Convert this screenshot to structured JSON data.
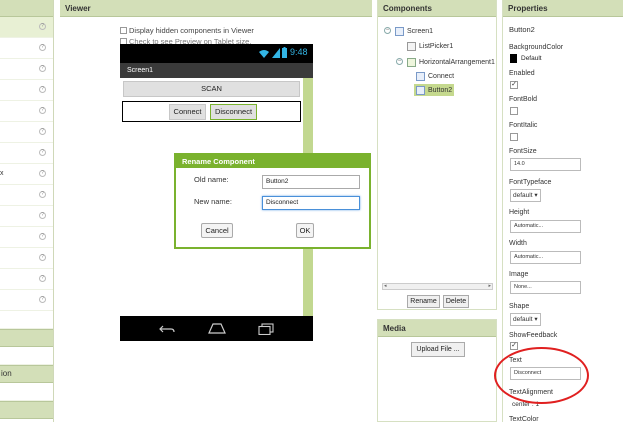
{
  "viewer": {
    "header": "Viewer",
    "display_hidden": "Display hidden components in Viewer",
    "preview_tablet": "Check to see Preview on Tablet size."
  },
  "phone": {
    "time": "9:48",
    "screen_title": "Screen1",
    "scan_label": "SCAN",
    "connect_label": "Connect",
    "disconnect_label": "Disconnect"
  },
  "rename_dialog": {
    "title": "Rename Component",
    "old_name_label": "Old name:",
    "old_name_value": "Button2",
    "new_name_label": "New name:",
    "new_name_value": "Disconnect",
    "cancel_label": "Cancel",
    "ok_label": "OK"
  },
  "palette": {
    "partial_x": "x",
    "partial_group": "ion"
  },
  "components": {
    "header": "Components",
    "tree": {
      "screen1": "Screen1",
      "listpicker1": "ListPicker1",
      "harr1": "HorizontalArrangement1",
      "connect": "Connect",
      "button2": "Button2"
    },
    "rename_label": "Rename",
    "delete_label": "Delete"
  },
  "media": {
    "header": "Media",
    "upload_label": "Upload File ..."
  },
  "properties": {
    "header": "Properties",
    "component_name": "Button2",
    "background_color_label": "BackgroundColor",
    "background_color_value": "Default",
    "enabled_label": "Enabled",
    "fontbold_label": "FontBold",
    "fontitalic_label": "FontItalic",
    "fontsize_label": "FontSize",
    "fontsize_value": "14.0",
    "fonttypeface_label": "FontTypeface",
    "fonttypeface_value": "default",
    "height_label": "Height",
    "height_value": "Automatic...",
    "width_label": "Width",
    "width_value": "Automatic...",
    "image_label": "Image",
    "image_value": "None...",
    "shape_label": "Shape",
    "shape_value": "default",
    "showfeedback_label": "ShowFeedback",
    "text_label": "Text",
    "text_value": "Disconnect",
    "textalignment_label": "TextAlignment",
    "textalignment_value": "center : 1",
    "textcolor_label": "TextColor"
  },
  "colors": {
    "accent": "#7ab22e",
    "header_bg": "#d3dfb8",
    "highlight": "#e02020"
  }
}
